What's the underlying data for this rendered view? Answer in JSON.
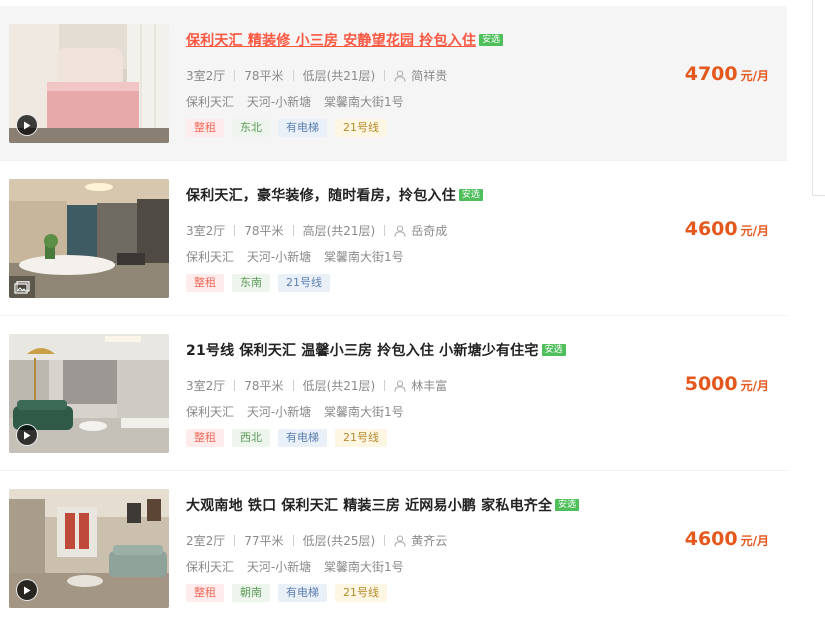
{
  "listings": [
    {
      "title": "保利天汇 精装修 小三房 安静望花园 拎包入住",
      "badge": "安选",
      "rooms": "3室2厅",
      "area": "78平米",
      "floor": "低层(共21层)",
      "agent": "简祥贵",
      "community": "保利天汇",
      "district": "天河-小新塘",
      "street": "棠馨南大街1号",
      "tags": [
        {
          "label": "整租",
          "style": "red"
        },
        {
          "label": "东北",
          "style": "green"
        },
        {
          "label": "有电梯",
          "style": "blue"
        },
        {
          "label": "21号线",
          "style": "yellow"
        }
      ],
      "price": "4700",
      "unit": "元/月",
      "media": "video-play-icon",
      "hovered": true
    },
    {
      "title": "保利天汇，豪华装修，随时看房，拎包入住",
      "badge": "安选",
      "rooms": "3室2厅",
      "area": "78平米",
      "floor": "高层(共21层)",
      "agent": "岳奇成",
      "community": "保利天汇",
      "district": "天河-小新塘",
      "street": "棠馨南大街1号",
      "tags": [
        {
          "label": "整租",
          "style": "red"
        },
        {
          "label": "东南",
          "style": "green"
        },
        {
          "label": "21号线",
          "style": "blue"
        }
      ],
      "price": "4600",
      "unit": "元/月",
      "media": "photo-album-icon",
      "hovered": false
    },
    {
      "title": "21号线 保利天汇 温馨小三房 拎包入住 小新塘少有住宅",
      "badge": "安选",
      "rooms": "3室2厅",
      "area": "78平米",
      "floor": "低层(共21层)",
      "agent": "林丰富",
      "community": "保利天汇",
      "district": "天河-小新塘",
      "street": "棠馨南大街1号",
      "tags": [
        {
          "label": "整租",
          "style": "red"
        },
        {
          "label": "西北",
          "style": "green"
        },
        {
          "label": "有电梯",
          "style": "blue"
        },
        {
          "label": "21号线",
          "style": "yellow"
        }
      ],
      "price": "5000",
      "unit": "元/月",
      "media": "video-play-icon",
      "hovered": false
    },
    {
      "title": "大观南地 铁口 保利天汇 精装三房 近网易小鹏 家私电齐全",
      "badge": "安选",
      "rooms": "2室2厅",
      "area": "77平米",
      "floor": "低层(共25层)",
      "agent": "黄齐云",
      "community": "保利天汇",
      "district": "天河-小新塘",
      "street": "棠馨南大街1号",
      "tags": [
        {
          "label": "整租",
          "style": "red"
        },
        {
          "label": "朝南",
          "style": "green"
        },
        {
          "label": "有电梯",
          "style": "blue"
        },
        {
          "label": "21号线",
          "style": "yellow"
        }
      ],
      "price": "4600",
      "unit": "元/月",
      "media": "video-play-icon",
      "hovered": false
    }
  ],
  "colors": {
    "price": "#e4581e",
    "title_hover": "#fa5741",
    "select_badge": "#4fbf5c",
    "tag_red_bg": "#fdeceb",
    "tag_red_text": "#f06a5b",
    "tag_green_bg": "#edf5ec",
    "tag_green_text": "#5d9b5a",
    "tag_blue_bg": "#eaf0f8",
    "tag_blue_text": "#5d7fb0",
    "tag_yellow_bg": "#fdf6e3",
    "tag_yellow_text": "#b48b2e"
  }
}
